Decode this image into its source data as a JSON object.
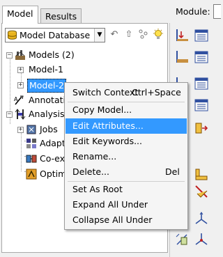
{
  "tabs": [
    {
      "label": "Model",
      "active": true
    },
    {
      "label": "Results",
      "active": false
    }
  ],
  "toolbar": {
    "model_database_label": "Model Database",
    "icons": [
      "model-database-icon",
      "dropdown-arrow-icon",
      "back-icon",
      "forward-icon",
      "filter-icon",
      "lightbulb-icon"
    ]
  },
  "tree": {
    "models_label": "Models (2)",
    "model1_label": "Model-1",
    "model2_label": "Model-2",
    "annotations_label": "Annotations",
    "analysis_label": "Analysis",
    "jobs_label": "Jobs",
    "adaptivity_label": "Adaptivity Processes",
    "cosim_label": "Co-executions",
    "opt_label": "Optimization Processes"
  },
  "context_menu": {
    "items": [
      {
        "label": "Switch Context",
        "shortcut": "Ctrl+Space"
      },
      {
        "label": "Copy Model..."
      },
      {
        "label": "Edit Attributes...",
        "highlighted": true
      },
      {
        "label": "Edit Keywords..."
      },
      {
        "label": "Rename..."
      },
      {
        "label": "Delete...",
        "shortcut": "Del"
      },
      {
        "label": "Set As Root"
      },
      {
        "label": "Expand All Under"
      },
      {
        "label": "Collapse All Under"
      }
    ]
  },
  "module": {
    "label": "Module:"
  },
  "colors": {
    "selection": "#3399ff",
    "panel_bg": "#ffffff",
    "window_bg": "#f0f0f0"
  }
}
